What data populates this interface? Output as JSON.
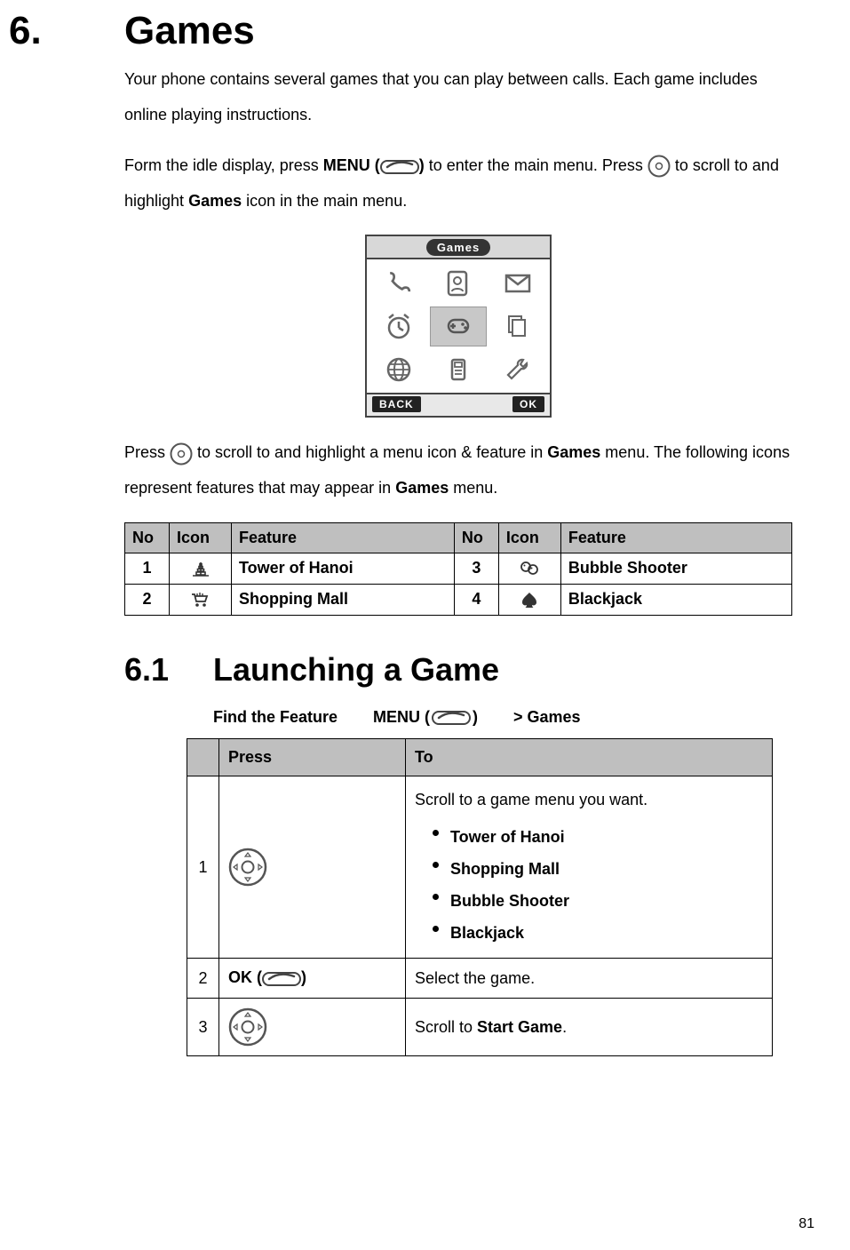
{
  "section": {
    "number": "6.",
    "title": "Games",
    "intro_1": "Your phone contains several games that you can play between calls. Each game includes online playing instructions.",
    "intro_2a": "Form the idle display, press ",
    "intro_2_menu_label": "MENU (",
    "intro_2_menu_close": ")",
    "intro_2b": " to enter the main menu. Press ",
    "intro_2c": " to scroll to and highlight ",
    "intro_2_games": "Games",
    "intro_2d": " icon in the main menu.",
    "intro_3a": "Press ",
    "intro_3b": " to scroll to and highlight a menu icon & feature in ",
    "intro_3_games": "Games",
    "intro_3c": " menu. The following icons represent features that may appear in ",
    "intro_3_games2": "Games",
    "intro_3d": " menu."
  },
  "phone": {
    "title": "Games",
    "left_soft": "BACK",
    "right_soft": "OK"
  },
  "features_header": {
    "no": "No",
    "icon": "Icon",
    "feature": "Feature"
  },
  "features": [
    {
      "no": "1",
      "icon": "hanoi",
      "feature": "Tower of Hanoi",
      "no2": "3",
      "icon2": "bubble",
      "feature2": "Bubble Shooter"
    },
    {
      "no": "2",
      "icon": "cart",
      "feature": "Shopping Mall",
      "no2": "4",
      "icon2": "spade",
      "feature2": "Blackjack"
    }
  ],
  "sub": {
    "number": "6.1",
    "title": "Launching a Game"
  },
  "find_feature": {
    "label": "Find the Feature",
    "menu_text": "MENU (",
    "menu_close": ")",
    "path": "> Games"
  },
  "steps_header": {
    "press": "Press",
    "to": "To"
  },
  "steps": [
    {
      "num": "1",
      "press_type": "nav",
      "to_intro": "Scroll to a game menu you want.",
      "items": [
        "Tower of Hanoi",
        "Shopping Mall",
        "Bubble Shooter",
        "Blackjack"
      ]
    },
    {
      "num": "2",
      "press_type": "ok",
      "press_label_a": "OK (",
      "press_label_b": ")",
      "to_plain_a": "Select the game."
    },
    {
      "num": "3",
      "press_type": "nav",
      "to_plain_a": "Scroll to ",
      "to_bold": "Start Game",
      "to_plain_b": "."
    }
  ],
  "page_number": "81"
}
